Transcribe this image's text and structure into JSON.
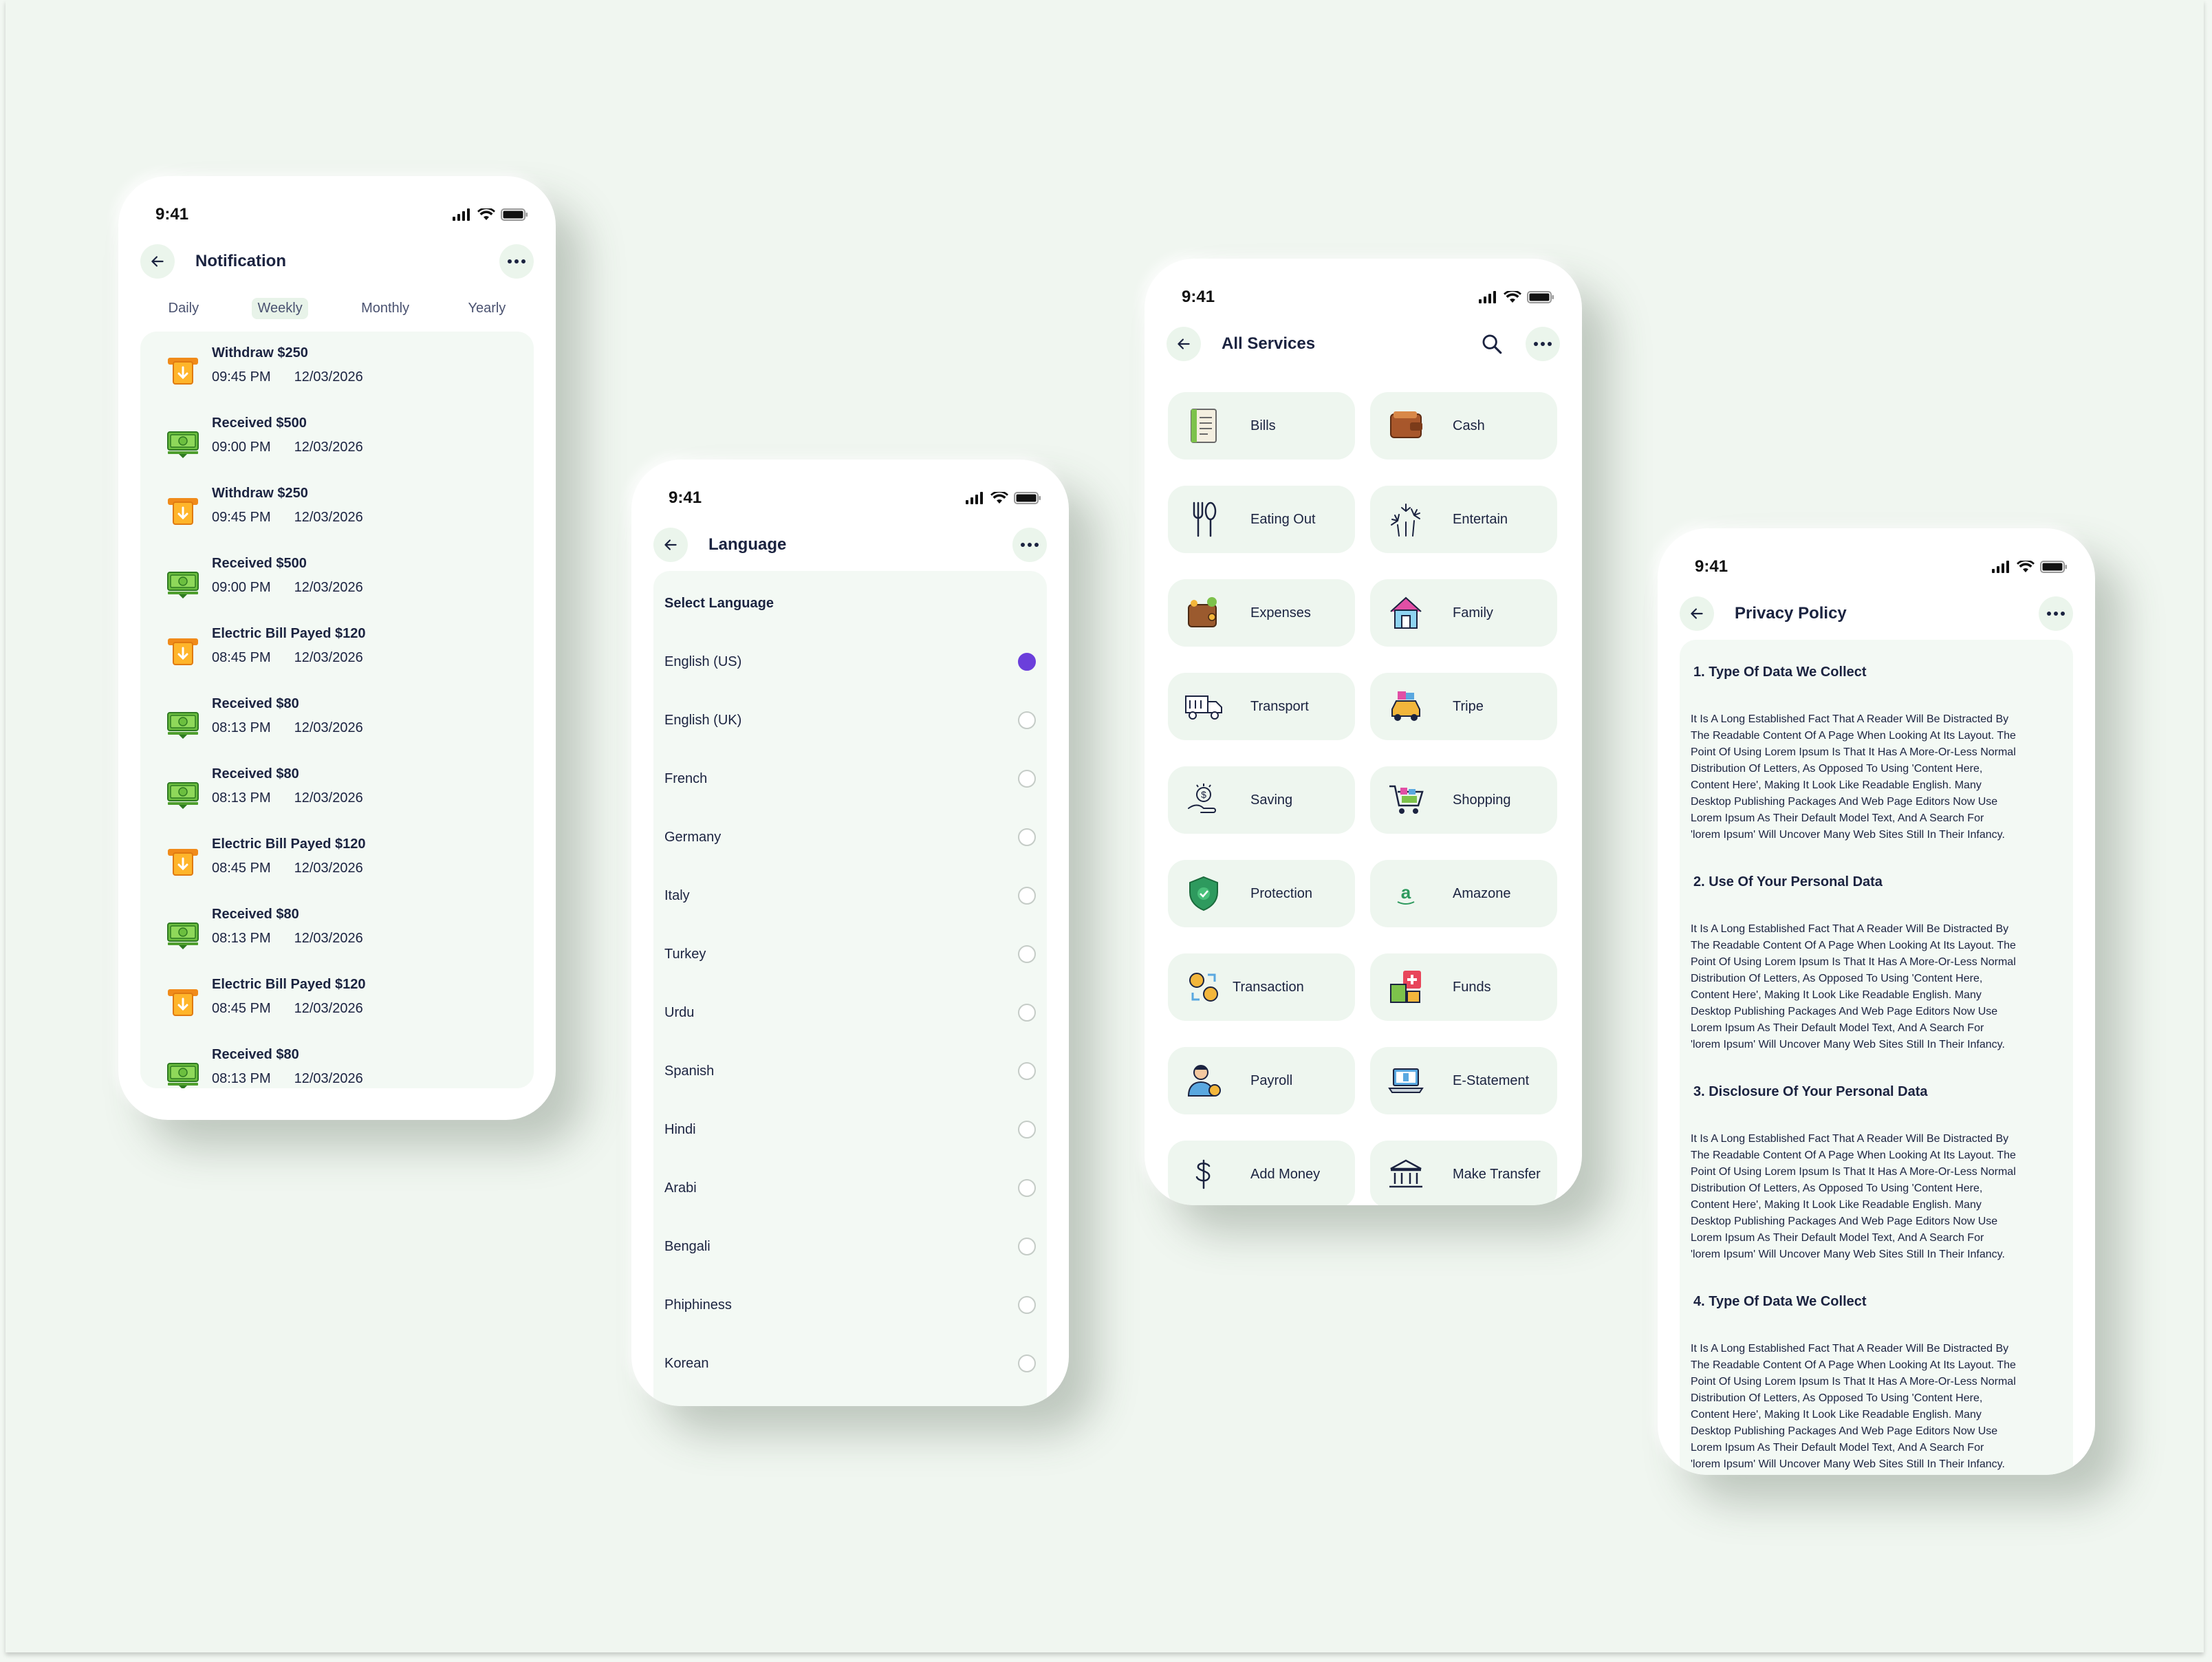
{
  "status": {
    "time": "9:41"
  },
  "notification": {
    "title": "Notification",
    "tabs": [
      "Daily",
      "Weekly",
      "Monthly",
      "Yearly"
    ],
    "active_tab": "Weekly",
    "items": [
      {
        "title": "Withdraw $250",
        "time": "09:45 PM",
        "date": "12/03/2026",
        "icon": "atm-withdraw-icon"
      },
      {
        "title": "Received $500",
        "time": "09:00 PM",
        "date": "12/03/2026",
        "icon": "cash-stack-icon"
      },
      {
        "title": "Withdraw $250",
        "time": "09:45 PM",
        "date": "12/03/2026",
        "icon": "atm-withdraw-icon"
      },
      {
        "title": "Received $500",
        "time": "09:00 PM",
        "date": "12/03/2026",
        "icon": "cash-stack-icon"
      },
      {
        "title": "Electric Bill Payed  $120",
        "time": "08:45 PM",
        "date": "12/03/2026",
        "icon": "atm-withdraw-icon"
      },
      {
        "title": "Received $80",
        "time": "08:13 PM",
        "date": "12/03/2026",
        "icon": "cash-stack-icon"
      },
      {
        "title": "Received $80",
        "time": "08:13 PM",
        "date": "12/03/2026",
        "icon": "cash-stack-icon"
      },
      {
        "title": "Electric Bill Payed  $120",
        "time": "08:45 PM",
        "date": "12/03/2026",
        "icon": "atm-withdraw-icon"
      },
      {
        "title": "Received $80",
        "time": "08:13 PM",
        "date": "12/03/2026",
        "icon": "cash-stack-icon"
      },
      {
        "title": "Electric Bill Payed  $120",
        "time": "08:45 PM",
        "date": "12/03/2026",
        "icon": "atm-withdraw-icon"
      },
      {
        "title": "Received $80",
        "time": "08:13 PM",
        "date": "12/03/2026",
        "icon": "cash-stack-icon"
      }
    ]
  },
  "language": {
    "title": "Language",
    "section": "Select Language",
    "selected": "English (US)",
    "options": [
      "English (US)",
      "English (UK)",
      "French",
      "Germany",
      "Italy",
      "Turkey",
      "Urdu",
      "Spanish",
      "Hindi",
      "Arabi",
      "Bengali",
      "Phiphiness",
      "Korean"
    ]
  },
  "services": {
    "title": "All Services",
    "items": [
      {
        "label": "Bills",
        "icon": "bill-receipt-icon"
      },
      {
        "label": "Cash",
        "icon": "wallet-icon"
      },
      {
        "label": "Eating Out",
        "icon": "fork-spoon-icon"
      },
      {
        "label": "Entertain",
        "icon": "fireworks-icon"
      },
      {
        "label": "Expenses",
        "icon": "wallet-coins-icon"
      },
      {
        "label": "Family",
        "icon": "house-icon"
      },
      {
        "label": "Transport",
        "icon": "truck-icon"
      },
      {
        "label": "Tripe",
        "icon": "car-luggage-icon"
      },
      {
        "label": "Saving",
        "icon": "hand-coin-icon"
      },
      {
        "label": "Shopping",
        "icon": "shopping-cart-icon"
      },
      {
        "label": "Protection",
        "icon": "shield-check-icon"
      },
      {
        "label": "Amazone",
        "icon": "amazon-icon"
      },
      {
        "label": "Transaction",
        "icon": "exchange-coins-icon"
      },
      {
        "label": "Funds",
        "icon": "medical-funds-icon"
      },
      {
        "label": "Payroll",
        "icon": "employee-pay-icon"
      },
      {
        "label": "E-Statement",
        "icon": "laptop-icon"
      },
      {
        "label": "Add Money",
        "icon": "dollar-icon"
      },
      {
        "label": "Make Transfer",
        "icon": "bank-icon"
      }
    ]
  },
  "privacy": {
    "title": "Privacy Policy",
    "sections": [
      {
        "heading": "1.  Type Of Data We Collect",
        "lines": [
          "It Is A Long Established Fact That A Reader Will Be Distracted By",
          "The Readable Content Of A Page When Looking At Its Layout. The",
          "Point Of Using Lorem Ipsum Is That It Has A More-Or-Less Normal",
          "Distribution Of Letters, As Opposed To Using 'Content Here,",
          "Content Here', Making It Look Like Readable English. Many",
          "Desktop Publishing Packages And Web Page Editors Now Use",
          "Lorem Ipsum As Their Default Model Text, And A Search For",
          "'lorem Ipsum' Will Uncover Many Web Sites Still In Their Infancy."
        ]
      },
      {
        "heading": "2. Use Of Your Personal Data",
        "lines": [
          "It Is A Long Established Fact That A Reader Will Be Distracted By",
          "The Readable Content Of A Page When Looking At Its Layout. The",
          "Point Of Using Lorem Ipsum Is That It Has A More-Or-Less Normal",
          "Distribution Of Letters, As Opposed To Using 'Content Here,",
          "Content Here', Making It Look Like Readable English. Many",
          "Desktop Publishing Packages And Web Page Editors Now Use",
          "Lorem Ipsum As Their Default Model Text, And A Search For",
          "'lorem Ipsum' Will Uncover Many Web Sites Still In Their Infancy."
        ]
      },
      {
        "heading": "3. Disclosure Of Your Personal Data",
        "lines": [
          "It Is A Long Established Fact That A Reader Will Be Distracted By",
          "The Readable Content Of A Page When Looking At Its Layout. The",
          "Point Of Using Lorem Ipsum Is That It Has A More-Or-Less Normal",
          "Distribution Of Letters, As Opposed To Using 'Content Here,",
          "Content Here', Making It Look Like Readable English. Many",
          "Desktop Publishing Packages And Web Page Editors Now Use",
          "Lorem Ipsum As Their Default Model Text, And A Search For",
          "'lorem Ipsum' Will Uncover Many Web Sites Still In Their Infancy."
        ]
      },
      {
        "heading": "4.  Type Of Data We Collect",
        "lines": [
          "It Is A Long Established Fact That A Reader Will Be Distracted By",
          "The Readable Content Of A Page When Looking At Its Layout. The",
          "Point Of Using Lorem Ipsum Is That It Has A More-Or-Less Normal",
          "Distribution Of Letters, As Opposed To Using 'Content Here,",
          "Content Here', Making It Look Like Readable English. Many",
          "Desktop Publishing Packages And Web Page Editors Now Use",
          "Lorem Ipsum As Their Default Model Text, And A Search For",
          "'lorem Ipsum' Will Uncover Many Web Sites Still In Their Infancy."
        ]
      }
    ]
  },
  "colors": {
    "background": "#f0f6f0",
    "panel": "#f3f9f4",
    "accent_radio": "#6b3fdb",
    "text": "#1b2340"
  }
}
